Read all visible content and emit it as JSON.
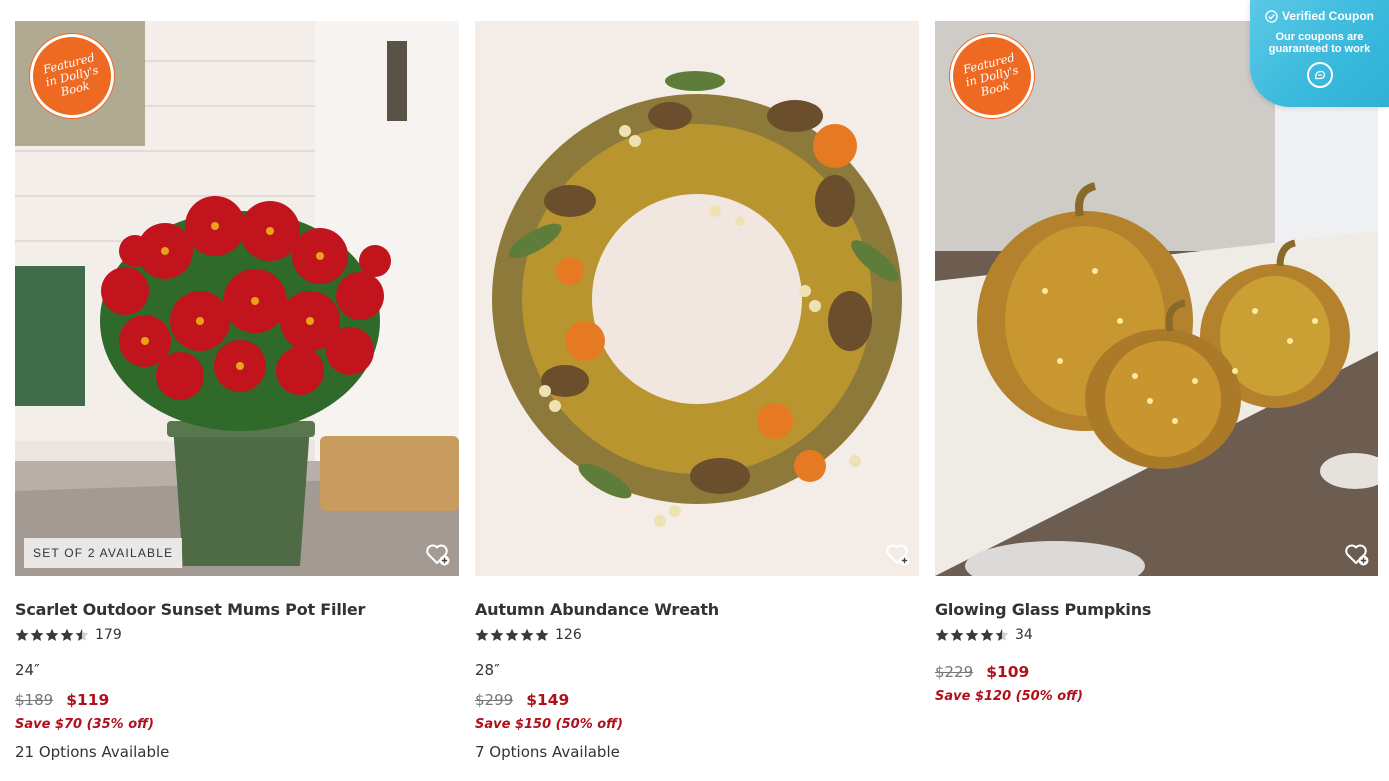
{
  "products": [
    {
      "name": "Scarlet Outdoor Sunset Mums Pot Filler",
      "featured_badge": "Featured in Dolly's Book",
      "set_tag": "SET OF 2 AVAILABLE",
      "rating": 4.5,
      "review_count": "179",
      "size": "24″",
      "original_price": "$189",
      "sale_price": "$119",
      "savings": "Save $70 (35% off)",
      "options": "21 Options Available",
      "wishlist_icon": "heart-plus-icon"
    },
    {
      "name": "Autumn Abundance Wreath",
      "featured_badge": "",
      "set_tag": "",
      "rating": 5,
      "review_count": "126",
      "size": "28″",
      "original_price": "$299",
      "sale_price": "$149",
      "savings": "Save $150 (50% off)",
      "options": "7 Options Available",
      "wishlist_icon": "heart-plus-icon"
    },
    {
      "name": "Glowing Glass Pumpkins",
      "featured_badge": "Featured in Dolly's Book",
      "set_tag": "",
      "rating": 4.5,
      "review_count": "34",
      "size": "",
      "original_price": "$229",
      "sale_price": "$109",
      "savings": "Save $120 (50% off)",
      "options": "",
      "wishlist_icon": "heart-plus-icon"
    }
  ],
  "coupon_widget": {
    "title": "Verified Coupon",
    "subtitle": "Our coupons are guaranteed to work",
    "icon": "check-circle-icon"
  },
  "colors": {
    "sale": "#b0101b",
    "badge": "#ee6a23",
    "coupon": "#39b9dc",
    "text": "#333333"
  }
}
